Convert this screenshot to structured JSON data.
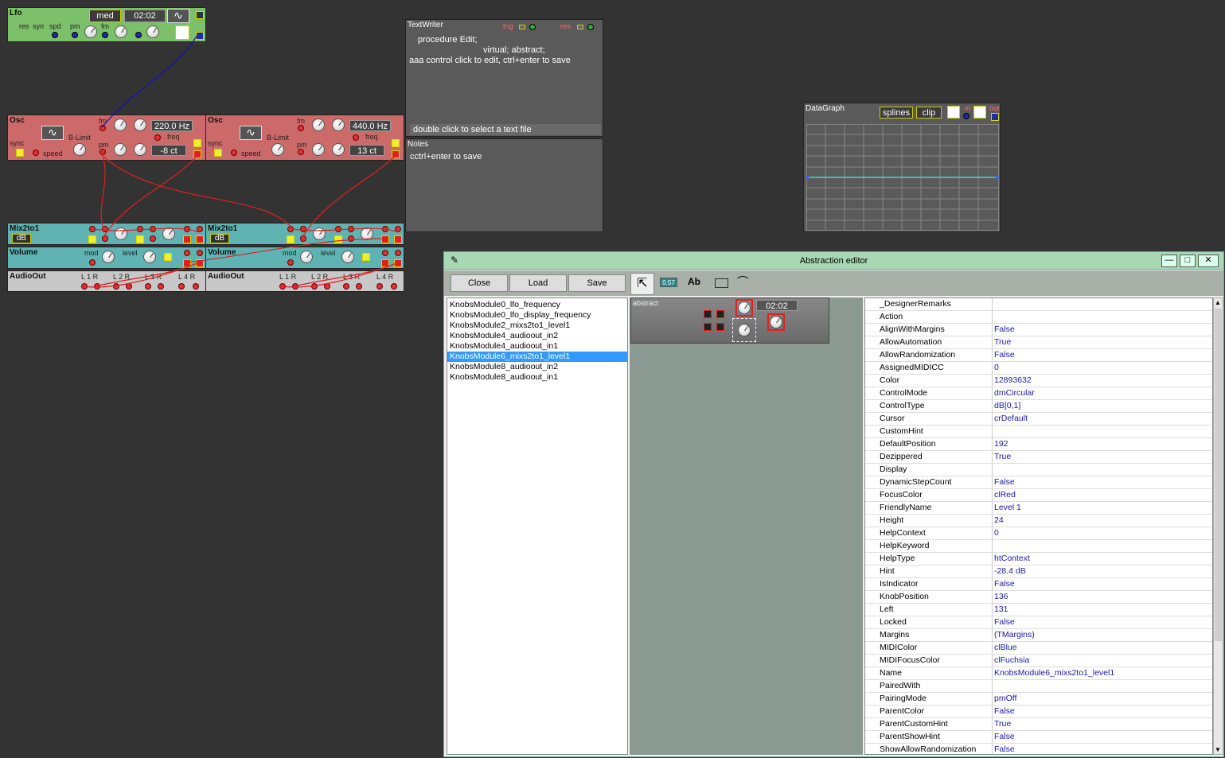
{
  "lfo": {
    "title": "Lfo",
    "mode": "med",
    "time": "02:02",
    "labels": [
      "res",
      "syn",
      "spd",
      "pm",
      "fm"
    ]
  },
  "osc1": {
    "title": "Osc",
    "freq": "220.0 Hz",
    "cents": "-8 ct",
    "fm": "fm",
    "pm": "pm",
    "freq_lbl": "freq",
    "blimit": "B-Limit",
    "sync": "sync",
    "speed": "speed"
  },
  "osc2": {
    "title": "Osc",
    "freq": "440.0 Hz",
    "cents": "13 ct",
    "fm": "fm",
    "pm": "pm",
    "freq_lbl": "freq",
    "blimit": "B-Limit",
    "sync": "sync",
    "speed": "speed"
  },
  "mix1": {
    "title": "Mix2to1",
    "unit": "dB"
  },
  "mix2": {
    "title": "Mix2to1",
    "unit": "dB"
  },
  "vol1": {
    "title": "Volume",
    "mod": "mod",
    "level": "level"
  },
  "vol2": {
    "title": "Volume",
    "mod": "mod",
    "level": "level"
  },
  "aout1": {
    "title": "AudioOut",
    "ch": [
      "L 1 R",
      "L 2 R",
      "L 3 R",
      "L 4 R"
    ]
  },
  "aout2": {
    "title": "AudioOut",
    "ch": [
      "L 1 R",
      "L 2 R",
      "L 3 R",
      "L 4 R"
    ]
  },
  "textwriter": {
    "title": "TextWriter",
    "trig": "trig",
    "res": "res.",
    "code1": "procedure  Edit;",
    "code2": "virtual; abstract;",
    "code3": "aaa control click to edit, ctrl+enter to save",
    "status": "double click to select a text file"
  },
  "notes": {
    "title": "Notes",
    "text": "cctrl+enter to save"
  },
  "datagraph": {
    "title": "DataGraph",
    "splines": "splines",
    "clip": "clip",
    "in": "in",
    "out": "out"
  },
  "editor": {
    "title": "Abstraction editor",
    "buttons": {
      "close": "Close",
      "load": "Load",
      "save": "Save"
    },
    "tools": {
      "num": "0.57",
      "text": "Ab"
    },
    "list": [
      "KnobsModule0_lfo_frequency",
      "KnobsModule0_lfo_display_frequency",
      "KnobsModule2_mixs2to1_level1",
      "KnobsModule4_audioout_in2",
      "KnobsModule4_audioout_in1",
      "KnobsModule6_mixs2to1_level1",
      "KnobsModule8_audioout_in2",
      "KnobsModule8_audioout_in1"
    ],
    "selected_index": 5,
    "preview": {
      "title": "abstract",
      "time": "02:02"
    },
    "props": [
      [
        "_DesignerRemarks",
        ""
      ],
      [
        "Action",
        ""
      ],
      [
        "AlignWithMargins",
        "False"
      ],
      [
        "AllowAutomation",
        "True"
      ],
      [
        "AllowRandomization",
        "False"
      ],
      [
        "AssignedMIDICC",
        "0"
      ],
      [
        "Color",
        "12893632"
      ],
      [
        "ControlMode",
        "dmCircular"
      ],
      [
        "ControlType",
        "dB[0,1]"
      ],
      [
        "Cursor",
        "crDefault"
      ],
      [
        "CustomHint",
        ""
      ],
      [
        "DefaultPosition",
        "192"
      ],
      [
        "Dezippered",
        "True"
      ],
      [
        "Display",
        ""
      ],
      [
        "DynamicStepCount",
        "False"
      ],
      [
        "FocusColor",
        "clRed"
      ],
      [
        "FriendlyName",
        "Level 1"
      ],
      [
        "Height",
        "24"
      ],
      [
        "HelpContext",
        "0"
      ],
      [
        "HelpKeyword",
        ""
      ],
      [
        "HelpType",
        "htContext"
      ],
      [
        "Hint",
        "-28.4 dB"
      ],
      [
        "IsIndicator",
        "False"
      ],
      [
        "KnobPosition",
        "136"
      ],
      [
        "Left",
        "131"
      ],
      [
        "Locked",
        "False"
      ],
      [
        "Margins",
        "(TMargins)"
      ],
      [
        "MIDIColor",
        "clBlue"
      ],
      [
        "MIDIFocusColor",
        "clFuchsia"
      ],
      [
        "Name",
        "KnobsModule6_mixs2to1_level1"
      ],
      [
        "PairedWith",
        ""
      ],
      [
        "PairingMode",
        "pmOff"
      ],
      [
        "ParentColor",
        "False"
      ],
      [
        "ParentCustomHint",
        "True"
      ],
      [
        "ParentShowHint",
        "False"
      ],
      [
        "ShowAllowRandomization",
        "False"
      ]
    ]
  }
}
